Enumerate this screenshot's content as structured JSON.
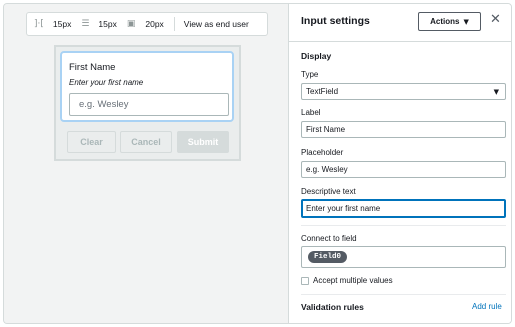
{
  "toolbar": {
    "items": [
      {
        "icon": "horizontal-spacing-icon",
        "value": "15px"
      },
      {
        "icon": "vertical-spacing-icon",
        "value": "15px"
      },
      {
        "icon": "outer-padding-icon",
        "value": "20px"
      }
    ],
    "view_label": "View as end user"
  },
  "preview": {
    "label": "First Name",
    "description": "Enter your first name",
    "placeholder": "e.g. Wesley",
    "buttons": {
      "clear": "Clear",
      "cancel": "Cancel",
      "submit": "Submit"
    }
  },
  "panel": {
    "title": "Input settings",
    "actions_label": "Actions",
    "display_section": "Display",
    "type": {
      "label": "Type",
      "value": "TextField"
    },
    "label_field": {
      "label": "Label",
      "value": "First Name"
    },
    "placeholder_field": {
      "label": "Placeholder",
      "value": "e.g. Wesley"
    },
    "descriptive_field": {
      "label": "Descriptive text",
      "value": "Enter your first name"
    },
    "connect": {
      "label": "Connect to field",
      "token": "Field0"
    },
    "multiple_values": {
      "label": "Accept multiple values",
      "checked": false
    },
    "validation": {
      "title": "Validation rules",
      "add_label": "Add rule"
    }
  },
  "colors": {
    "accent": "#0073bb",
    "focus_ring": "#a9d2f4",
    "token_bg": "#545b64"
  }
}
